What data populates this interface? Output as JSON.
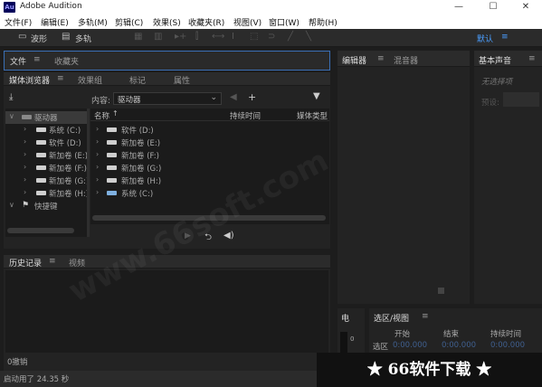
{
  "app": {
    "title": "Adobe Audition",
    "icon_text": "Au"
  },
  "window_controls": {
    "minimize": "—",
    "maximize": "☐",
    "close": "✕"
  },
  "menu": [
    "文件(F)",
    "编辑(E)",
    "多轨(M)",
    "剪辑(C)",
    "效果(S)",
    "收藏夹(R)",
    "视图(V)",
    "窗口(W)",
    "帮助(H)"
  ],
  "toolbar": {
    "waveform_label": "波形",
    "multitrack_label": "多轨",
    "workspace_label": "默认"
  },
  "files_panel": {
    "tabs": [
      "文件",
      "收藏夹"
    ]
  },
  "media_browser": {
    "tabs": [
      "媒体浏览器",
      "效果组",
      "标记",
      "属性"
    ],
    "content_label": "内容:",
    "content_value": "驱动器",
    "columns": [
      "名称",
      "持续时间",
      "媒体类型"
    ],
    "tree": [
      {
        "label": "驱动器",
        "level": 0
      },
      {
        "label": "系统 (C:)",
        "level": 1
      },
      {
        "label": "软件 (D:)",
        "level": 1
      },
      {
        "label": "新加卷 (E:)",
        "level": 1
      },
      {
        "label": "新加卷 (F:)",
        "level": 1
      },
      {
        "label": "新加卷 (G:)",
        "level": 1
      },
      {
        "label": "新加卷 (H:)",
        "level": 1
      },
      {
        "label": "快捷键",
        "level": 0
      }
    ],
    "list": [
      "软件 (D:)",
      "新加卷 (E:)",
      "新加卷 (F:)",
      "新加卷 (G:)",
      "新加卷 (H:)",
      "系统 (C:)"
    ]
  },
  "history_panel": {
    "tabs": [
      "历史记录",
      "视频"
    ],
    "undo_text": "0撤销"
  },
  "status": {
    "text": "启动用了 24.35 秒"
  },
  "editor_panel": {
    "tabs": [
      "编辑器",
      "混音器"
    ]
  },
  "essential_sound": {
    "tab": "基本声音",
    "no_selection": "无选择项",
    "preset_label": "预设:"
  },
  "levels_panel": {
    "tab": "电",
    "scale_value": "0"
  },
  "selection_view": {
    "tab": "选区/视图",
    "columns": [
      "开始",
      "结束",
      "持续时间"
    ],
    "row_label": "选区",
    "values": [
      "0:00.000",
      "0:00.000",
      "0:00.000"
    ]
  },
  "watermark": {
    "text": "★ 66软件下载 ★",
    "faint": "www.66soft.com"
  }
}
